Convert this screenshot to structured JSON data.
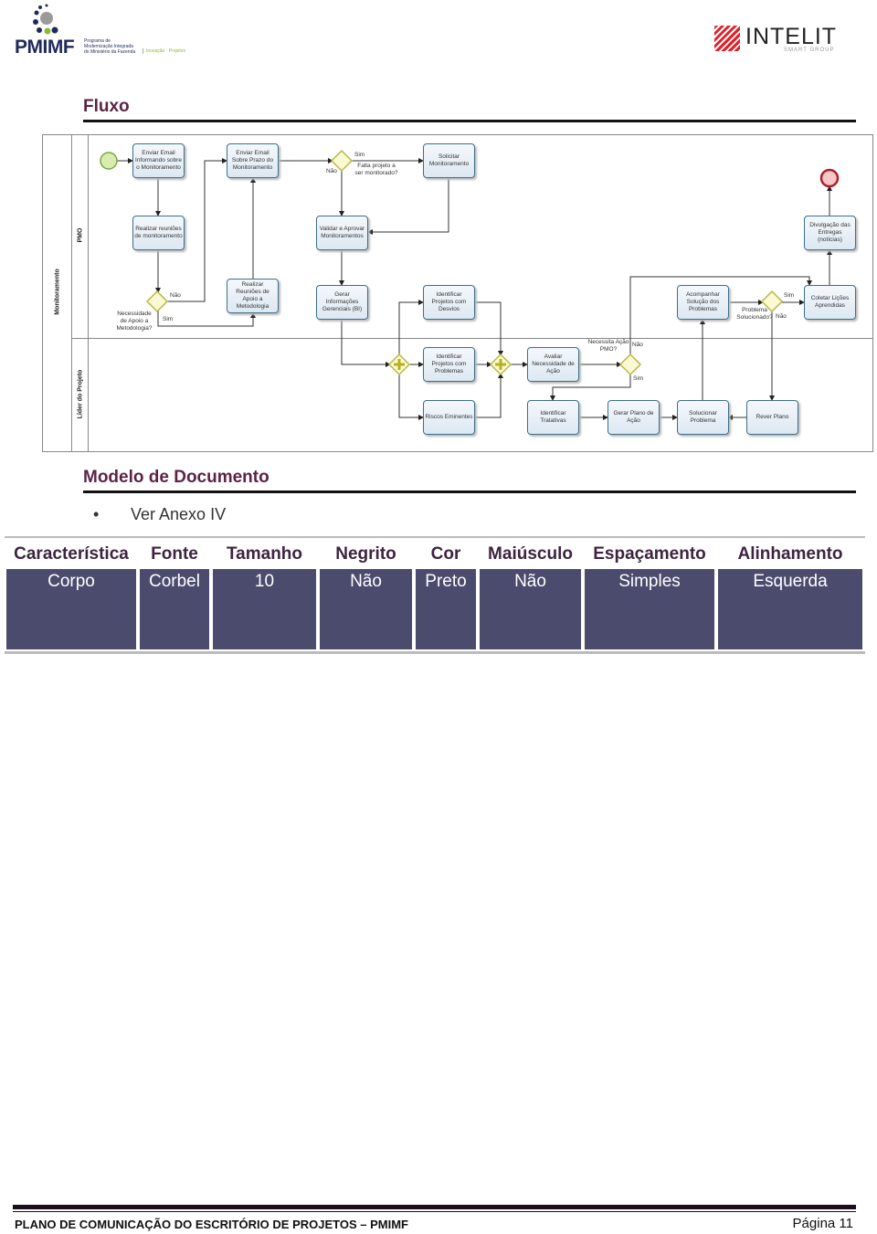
{
  "header": {
    "left_logo": {
      "name": "PMIMF",
      "subtitle": "Programa de Modernização Integrada do Ministério da Fazenda",
      "tagline": "Inovação · Projetos"
    },
    "right_logo": {
      "name": "INTELIT",
      "subtitle": "SMART GROUP"
    }
  },
  "sections": {
    "flow_title": "Fluxo",
    "doc_model_title": "Modelo de Documento",
    "bullet": "Ver Anexo IV"
  },
  "diagram": {
    "pool": "Monitoramento",
    "lanes": [
      "PMO",
      "Líder do Projeto"
    ],
    "tasks": {
      "t1": "Enviar Email Informando sobre o Monitoramento",
      "t2": "Enviar Email Sobre Prazo do Monitoramento",
      "t3": "Solicitar Monitoramento",
      "t4": "Realizar reuniões de monitoramento",
      "t5": "Validar e Aprovar Monitoramentos",
      "t6": "Divulgação das Entregas (notícias)",
      "t7": "Realizar Reuniões de Apoio a Metodologia",
      "t8": "Gerar Informações Gerenciais (BI)",
      "t9": "Identificar Projetos com Desvios",
      "t10": "Acompanhar Solução dos Problemas",
      "t11": "Coletar Lições Aprendidas",
      "t12": "Identificar Projetos com Problemas",
      "t13": "Avaliar Necessidade de Ação",
      "t14": "Riscos Eminentes",
      "t15": "Identificar Tratativas",
      "t16": "Gerar Plano de Ação",
      "t17": "Solucionar Problema",
      "t18": "Rever Plano"
    },
    "gateways": {
      "g1": {
        "question": "Falta projeto a ser monitorado?",
        "yes": "Sim",
        "no": "Não"
      },
      "g2": {
        "question": "Necessidade de Apoio a Metodologia?",
        "yes": "Sim",
        "no": "Não"
      },
      "g3": {
        "question": "Problema Solucionado?",
        "yes": "Sim",
        "no": "Não"
      },
      "g4": {
        "question": "Necessita Ação PMO?",
        "yes": "Sim",
        "no": "Não"
      }
    },
    "colors": {
      "start": "#d8ecb0",
      "end": "#f4c8c8",
      "end_border": "#b01c2a",
      "gateway": "#fafad2",
      "gateway_border": "#b8b84a",
      "task_border": "#3d6f8a"
    }
  },
  "table": {
    "headers": [
      "Característica",
      "Fonte",
      "Tamanho",
      "Negrito",
      "Cor",
      "Maiúsculo",
      "Espaçamento",
      "Alinhamento"
    ],
    "rows": [
      [
        "Corpo",
        "Corbel",
        "10",
        "Não",
        "Preto",
        "Não",
        "Simples",
        "Esquerda"
      ]
    ],
    "colors": {
      "cell_bg": "#4b4b6e",
      "header_text": "#3d2440"
    }
  },
  "footer": {
    "title": "PLANO DE COMUNICAÇÃO DO ESCRITÓRIO DE PROJETOS – PMIMF",
    "page": "Página 11"
  }
}
